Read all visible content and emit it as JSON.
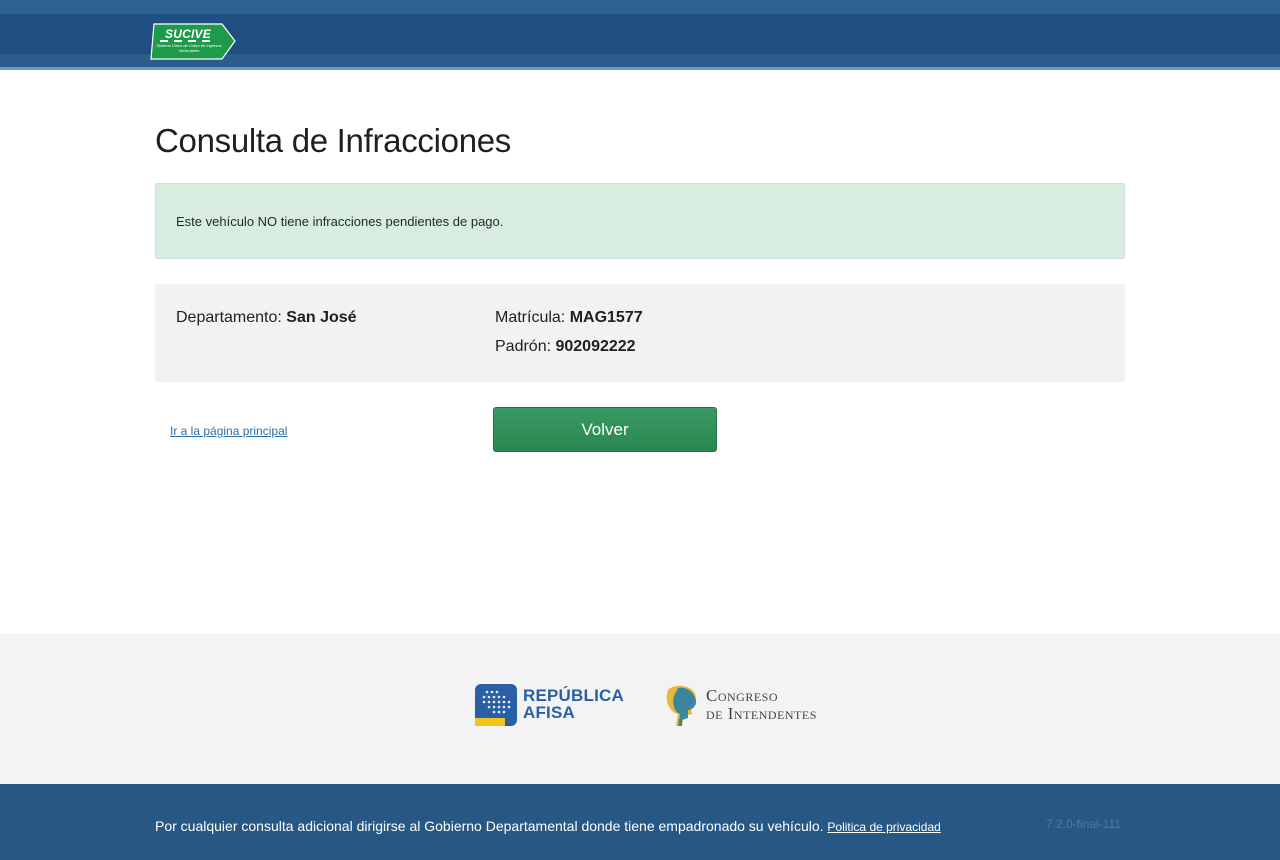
{
  "header": {
    "logo_title": "SUCIVE",
    "logo_subtitle": "Sistema Único de Cobro de Ingresos Vehiculares"
  },
  "main": {
    "title": "Consulta de Infracciones",
    "alert_message": "Este vehículo NO tiene infracciones pendientes de pago.",
    "info": {
      "departamento_label": "Departamento: ",
      "departamento_value": "San José",
      "matricula_label": "Matrícula: ",
      "matricula_value": "MAG1577",
      "padron_label": "Padrón: ",
      "padron_value": "902092222"
    },
    "home_link": "Ir a la página principal",
    "back_button": "Volver"
  },
  "partners": {
    "republica_line1": "REPÚBLICA",
    "republica_line2": "AFISA",
    "congreso_line1": "Congreso",
    "congreso_line2": "de Intendentes"
  },
  "footer": {
    "text": "Por cualquier consulta adicional dirigirse al Gobierno Departamental donde tiene empadronado su vehículo. ",
    "privacy_link": "Politica de privacidad",
    "version": "7.2.0-final-111"
  },
  "colors": {
    "header_blue": "#1f4f80",
    "footer_blue": "#275885",
    "success_bg": "#d8ece0",
    "button_green": "#2f8f58",
    "link_blue": "#2a6fa8"
  }
}
